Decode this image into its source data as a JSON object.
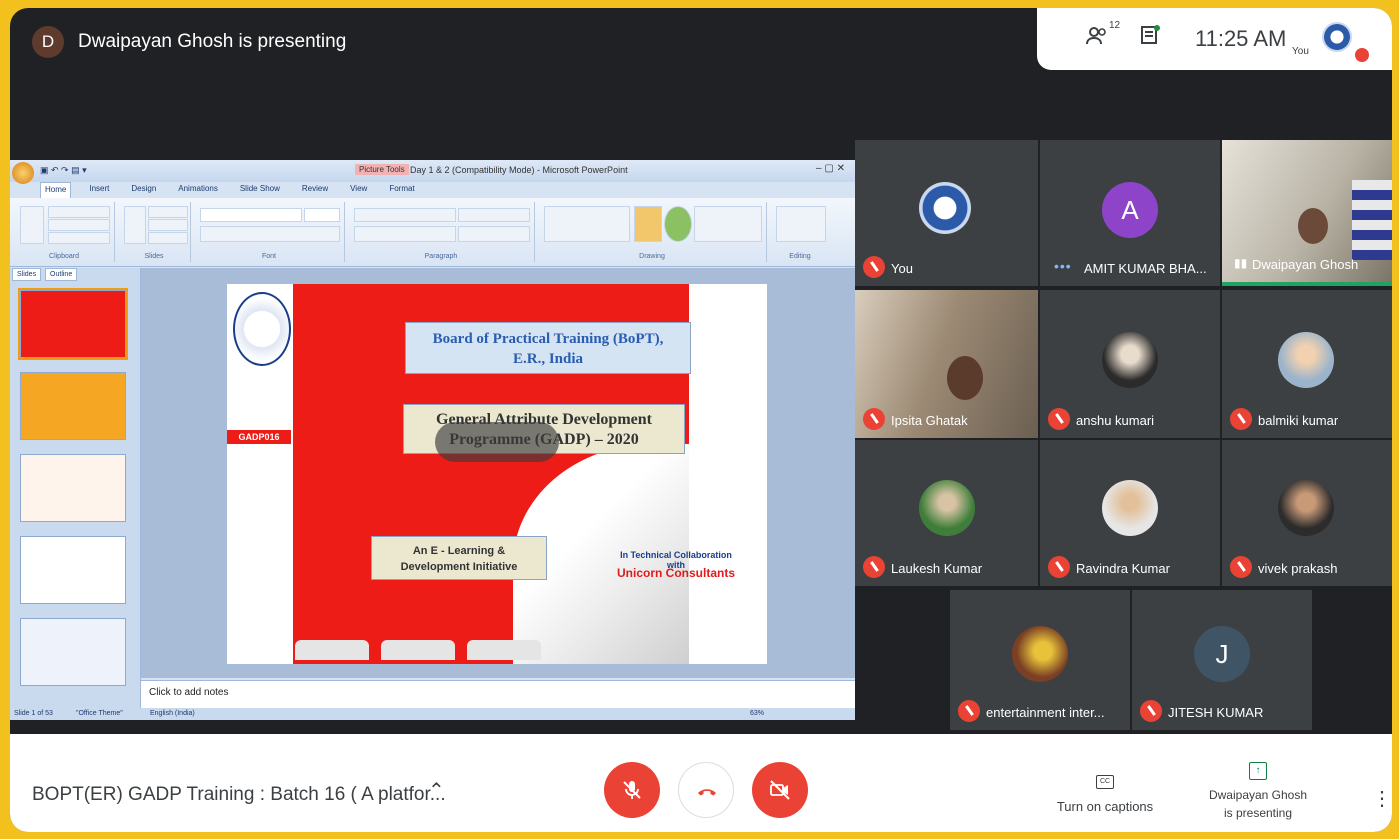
{
  "presenter_bar": {
    "initial": "D",
    "text": "Dwaipayan Ghosh is presenting"
  },
  "top_right": {
    "participants_count": "12",
    "time": "11:25 AM",
    "you_label": "You"
  },
  "powerpoint": {
    "context_tab": "Picture Tools",
    "window_title": "Day 1 & 2 (Compatibility Mode) - Microsoft PowerPoint",
    "tabs": [
      "Home",
      "Insert",
      "Design",
      "Animations",
      "Slide Show",
      "Review",
      "View",
      "Format"
    ],
    "ribbon_groups": [
      "Clipboard",
      "Slides",
      "Font",
      "Paragraph",
      "Drawing",
      "Editing"
    ],
    "thumb_tabs": [
      "Slides",
      "Outline"
    ],
    "notes_placeholder": "Click to add notes",
    "status_left": "Slide 1 of 53",
    "status_theme": "\"Office Theme\"",
    "status_lang": "English (India)",
    "zoom": "63%"
  },
  "slide": {
    "tag": "GADP016",
    "box1_line1": "Board of Practical Training (BoPT),",
    "box1_line2": "E.R., India",
    "box2_line1": "General Attribute Development",
    "box2_line2": "Programme (GADP) – 2020",
    "box3_line1": "An E - Learning &",
    "box3_line2": "Development Initiative",
    "collab": "In Technical Collaboration with",
    "partner": "Unicorn Consultants"
  },
  "participants": [
    {
      "name": "You"
    },
    {
      "name": "AMIT KUMAR BHA...",
      "initial": "A"
    },
    {
      "name": "Dwaipayan Ghosh"
    },
    {
      "name": "Ipsita Ghatak"
    },
    {
      "name": "anshu kumari"
    },
    {
      "name": "balmiki kumar"
    },
    {
      "name": "Laukesh Kumar"
    },
    {
      "name": "Ravindra Kumar"
    },
    {
      "name": "vivek prakash"
    },
    {
      "name": "entertainment inter..."
    },
    {
      "name": "JITESH KUMAR",
      "initial": "J"
    }
  ],
  "bottom_bar": {
    "meeting_title": "BOPT(ER) GADP Training : Batch 16 ( A platfor...",
    "captions_label": "Turn on captions",
    "cc_icon": "CC",
    "presenting_line1": "Dwaipayan Ghosh",
    "presenting_line2": "is presenting"
  },
  "colors": {
    "frame": "#f3c11e",
    "meet_bg": "#202124",
    "tile_bg": "#3c4043",
    "mute_red": "#ea4335",
    "slide_red": "#ee1c16",
    "avatar_purple": "#8e44c9",
    "avatar_slate": "#3f5566"
  }
}
